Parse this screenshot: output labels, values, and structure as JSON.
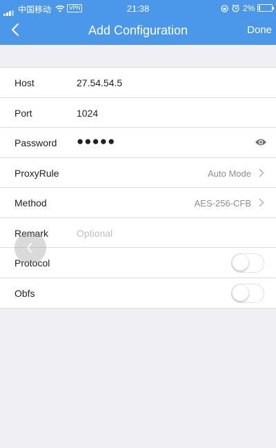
{
  "status_bar": {
    "carrier": "中国移动",
    "vpn": "VPN",
    "time": "21:38",
    "battery": "2%"
  },
  "nav": {
    "title": "Add Configuration",
    "done_label": "Done"
  },
  "fields": {
    "host": {
      "label": "Host",
      "value": "27.54.54.5"
    },
    "port": {
      "label": "Port",
      "value": "1024"
    },
    "password": {
      "label": "Password",
      "value": "●●●●●"
    },
    "proxy_rule": {
      "label": "ProxyRule",
      "value": "Auto Mode"
    },
    "method": {
      "label": "Method",
      "value": "AES-256-CFB"
    },
    "remark": {
      "label": "Remark",
      "placeholder": "Optional"
    },
    "protocol": {
      "label": "Protocol",
      "enabled": false
    },
    "obfs": {
      "label": "Obfs",
      "enabled": false
    }
  },
  "colors": {
    "nav_bg": "#4b98ea",
    "page_bg": "#efeff4",
    "separator": "#dcdce0"
  },
  "icons": [
    "back-chevron",
    "eye",
    "chevron-right",
    "wifi",
    "alarm",
    "rotation-lock",
    "battery"
  ]
}
